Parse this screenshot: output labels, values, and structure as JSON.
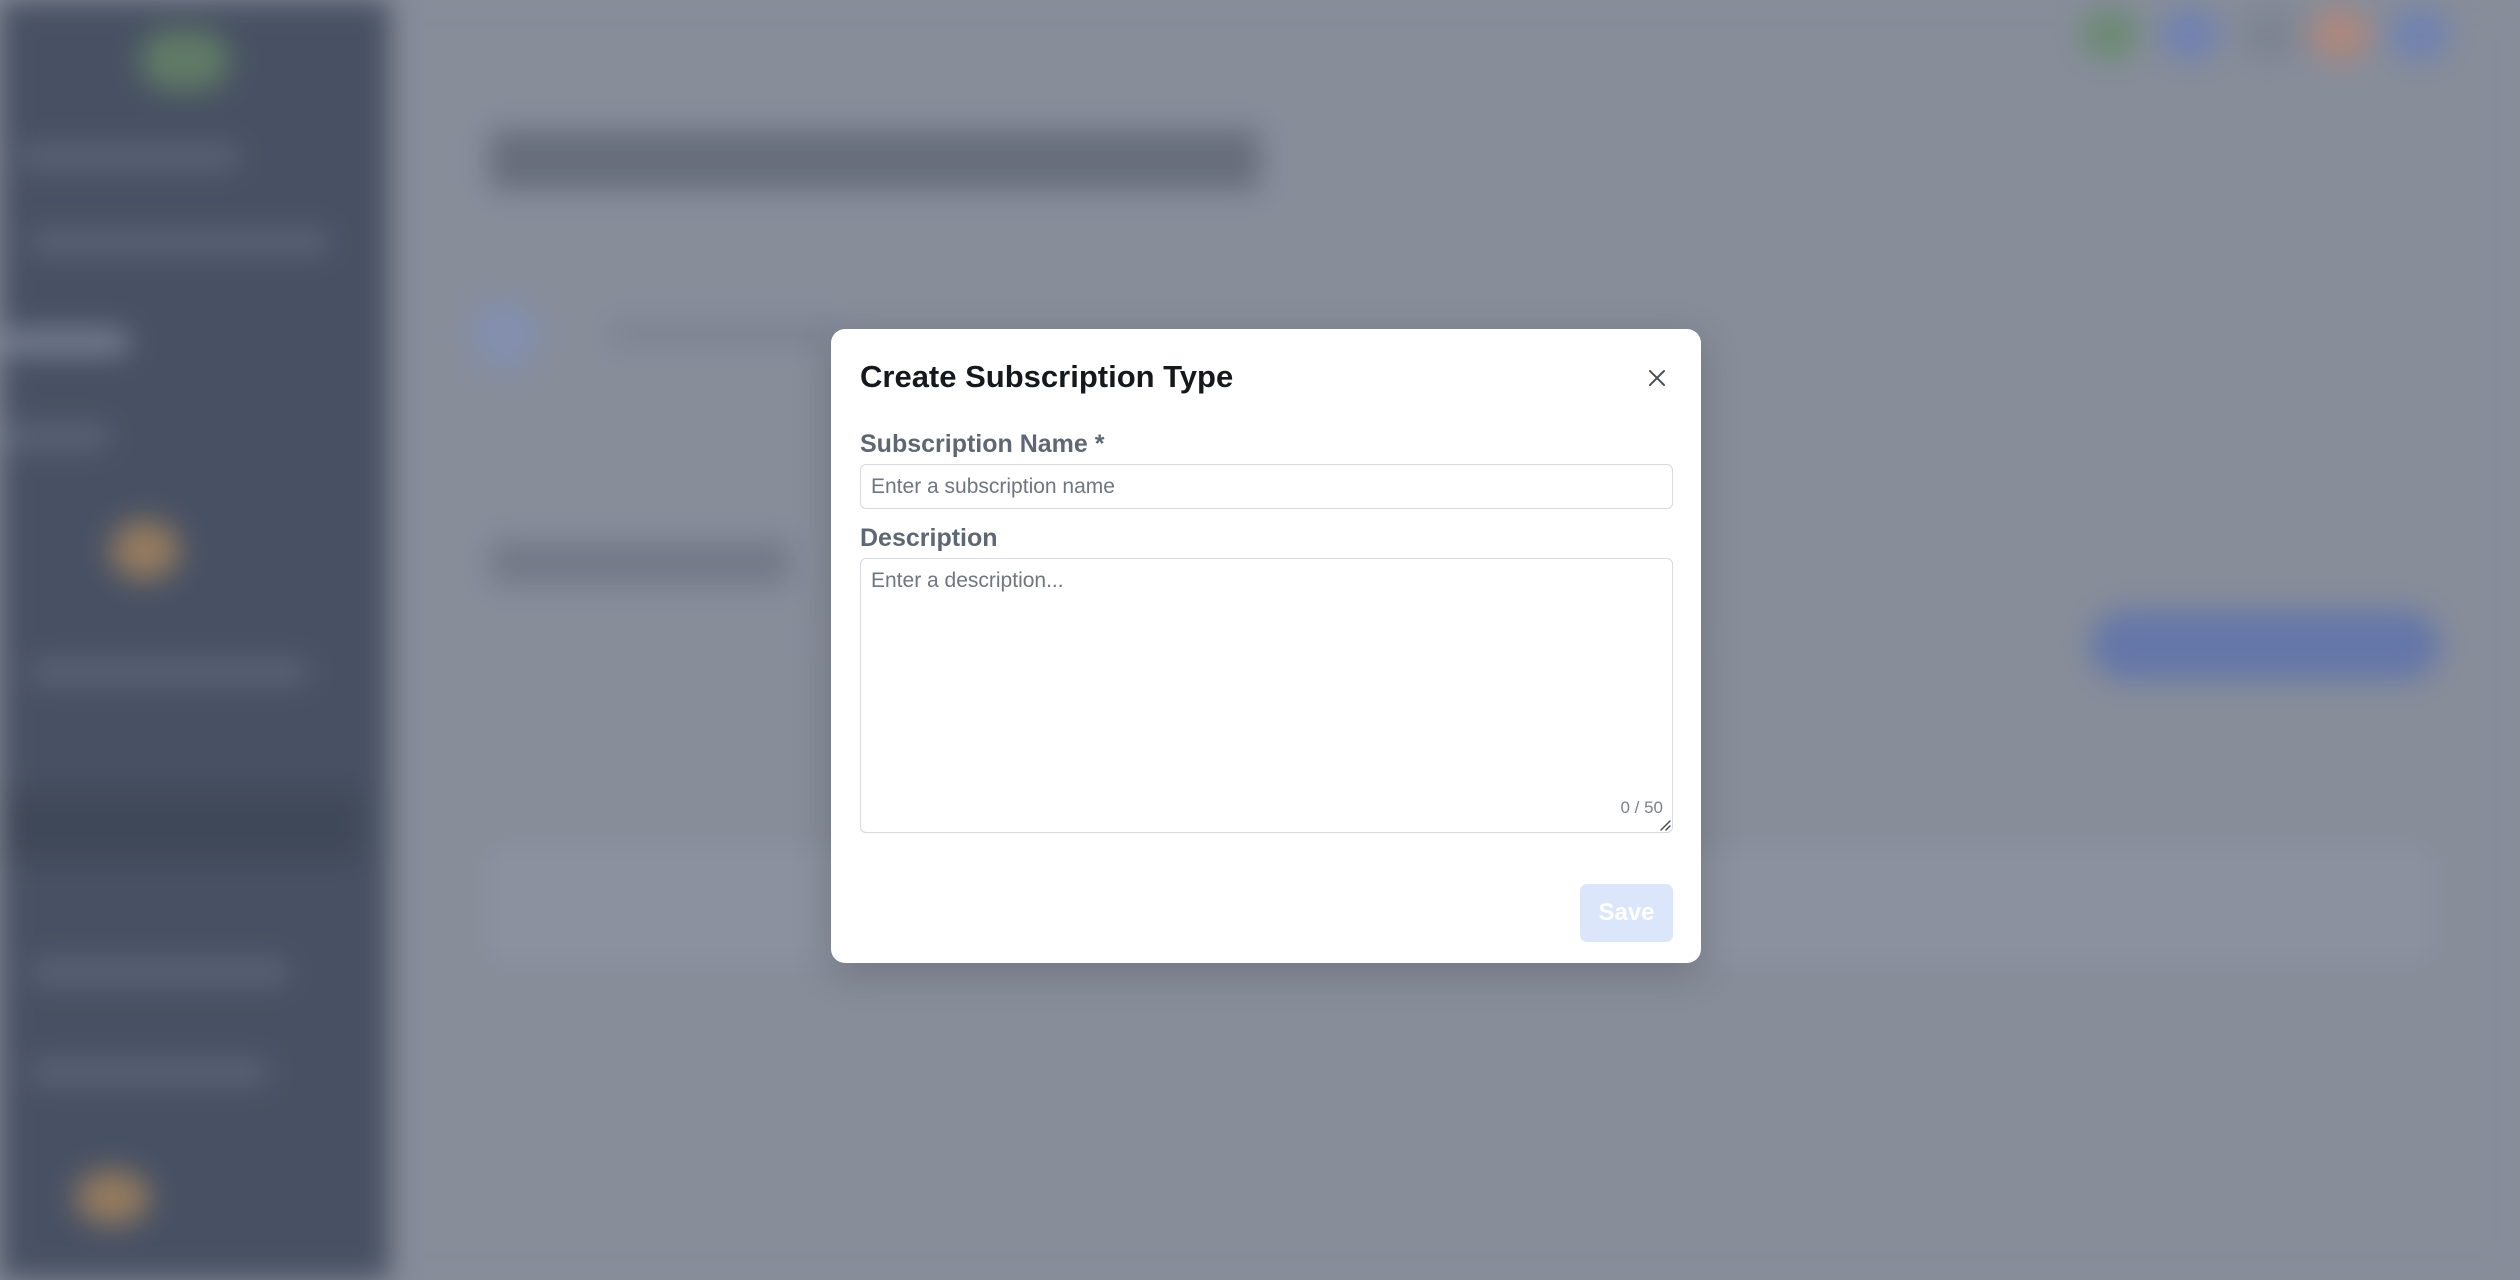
{
  "modal": {
    "title": "Create Subscription Type",
    "name_label": "Subscription Name *",
    "name_placeholder": "Enter a subscription name",
    "name_value": "",
    "description_label": "Description",
    "description_placeholder": "Enter a description...",
    "description_value": "",
    "char_count": "0 / 50",
    "save_label": "Save",
    "close_icon": "close-icon"
  },
  "colors": {
    "sidebar": "#3d4759",
    "backdrop": "#8a909c",
    "save_disabled": "#dce6fb",
    "modal_bg": "#ffffff"
  }
}
